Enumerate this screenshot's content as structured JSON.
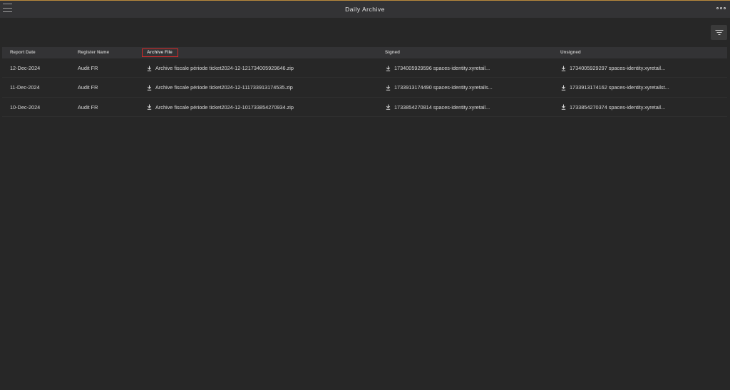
{
  "header": {
    "title": "Daily Archive",
    "menu_icon": "hamburger-menu-icon",
    "more_icon": "more-options-icon"
  },
  "toolbar": {
    "filter_icon": "filter-icon"
  },
  "table": {
    "columns": [
      "Report Date",
      "Register Name",
      "Archive File",
      "Signed",
      "Unsigned"
    ],
    "rows": [
      {
        "report_date": "12-Dec-2024",
        "register_name": "Audit FR",
        "archive_file": "Archive fiscale période ticket2024-12-121734005929646.zip",
        "signed": "1734005929596 spaces-identity.xyretail...",
        "unsigned": "1734005929297 spaces-identity.xyretail..."
      },
      {
        "report_date": "11-Dec-2024",
        "register_name": "Audit FR",
        "archive_file": "Archive fiscale période ticket2024-12-111733913174535.zip",
        "signed": "1733913174490 spaces-identity.xyretails...",
        "unsigned": "1733913174162 spaces-identity.xyretailst..."
      },
      {
        "report_date": "10-Dec-2024",
        "register_name": "Audit FR",
        "archive_file": "Archive fiscale période ticket2024-12-101733854270934.zip",
        "signed": "1733854270814 spaces-identity.xyretail...",
        "unsigned": "1733854270374 spaces-identity.xyretail..."
      }
    ]
  },
  "colors": {
    "background": "#272727",
    "header_bar": "#333335",
    "accent_line": "#b98a3c",
    "highlight_box": "#d62a2a"
  }
}
